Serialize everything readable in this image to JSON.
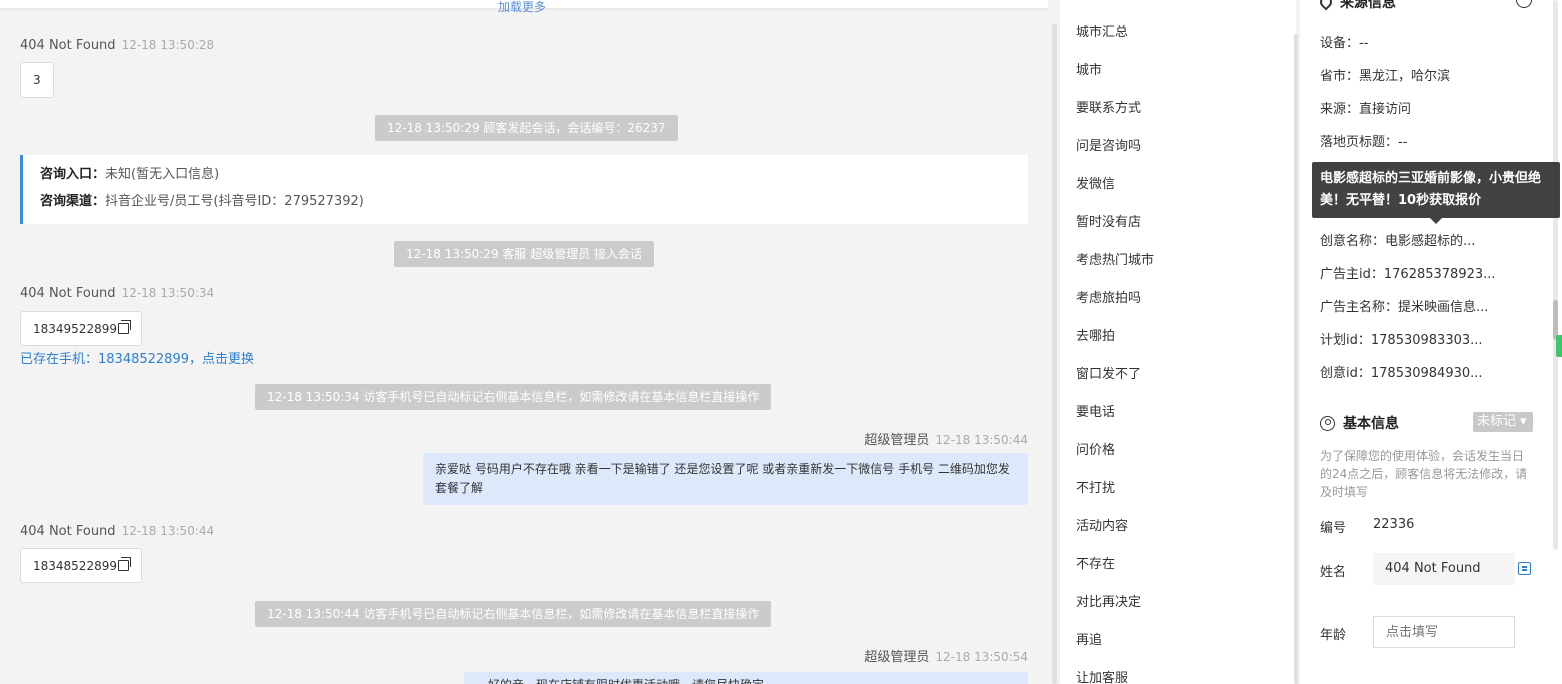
{
  "chat": {
    "load_more": "加载更多",
    "messages": [
      {
        "sender": "404 Not Found",
        "time": "12-18 13:50:28",
        "content": "3"
      },
      {
        "sender": "404 Not Found",
        "time": "12-18 13:50:34",
        "content": "18349522899"
      },
      {
        "sender": "404 Not Found",
        "time": "12-18 13:50:44",
        "content": "18348522899"
      }
    ],
    "system": [
      "12-18 13:50:29 顾客发起会话，会话编号：26237",
      "12-18 13:50:29 客服 超级管理员 接入会话",
      "12-18 13:50:34 访客手机号已自动标记右侧基本信息栏，如需修改请在基本信息栏直接操作",
      "12-18 13:50:44 访客手机号已自动标记右侧基本信息栏，如需修改请在基本信息栏直接操作"
    ],
    "info_card": {
      "entry_label": "咨询入口：",
      "entry_value": "未知(暂无入口信息)",
      "channel_label": "咨询渠道：",
      "channel_value": "抖音企业号/员工号(抖音号ID：279527392)"
    },
    "phone_exists_link": "已存在手机：18348522899，点击更换",
    "agent": [
      {
        "sender": "超级管理员",
        "time": "12-18 13:50:44",
        "content": "亲爱哒 号码用户不存在哦 亲看一下是输错了 还是您设置了呢 或者亲重新发一下微信号 手机号 二维码加您发套餐了解"
      },
      {
        "sender": "超级管理员",
        "time": "12-18 13:50:54",
        "content": "…好的亲，现在店铺有限时优惠活动哦，请您尽快确定…"
      }
    ]
  },
  "phrases": [
    "城市汇总",
    "城市",
    "要联系方式",
    "问是咨询吗",
    "发微信",
    "暂时没有店",
    "考虑热门城市",
    "考虑旅拍吗",
    "去哪拍",
    "窗口发不了",
    "要电话",
    "问价格",
    "不打扰",
    "活动内容",
    "不存在",
    "对比再决定",
    "再追",
    "让加客服"
  ],
  "source": {
    "title": "来源信息",
    "items": [
      {
        "label": "设备：",
        "value": "--"
      },
      {
        "label": "省市：",
        "value": "黑龙江，哈尔滨"
      },
      {
        "label": "来源：",
        "value": "直接访问"
      },
      {
        "label": "落地页标题：",
        "value": "--"
      },
      {
        "label": "创意名称：",
        "value": "电影感超标的..."
      },
      {
        "label": "广告主id：",
        "value": "176285378923..."
      },
      {
        "label": "广告主名称：",
        "value": "提米映画信息..."
      },
      {
        "label": "计划id：",
        "value": "178530983303..."
      },
      {
        "label": "创意id：",
        "value": "178530984930..."
      }
    ],
    "tooltip": "电影感超标的三亚婚前影像，小贵但绝美！无平替！10秒获取报价"
  },
  "basic": {
    "title": "基本信息",
    "tag_label": "未标记",
    "notice": "为了保障您的使用体验，会话发生当日的24点之后，顾客信息将无法修改，请及时填写",
    "id_label": "编号",
    "id_value": "22336",
    "name_label": "姓名",
    "name_value": "404 Not Found",
    "age_label": "年龄",
    "age_placeholder": "点击填写"
  }
}
